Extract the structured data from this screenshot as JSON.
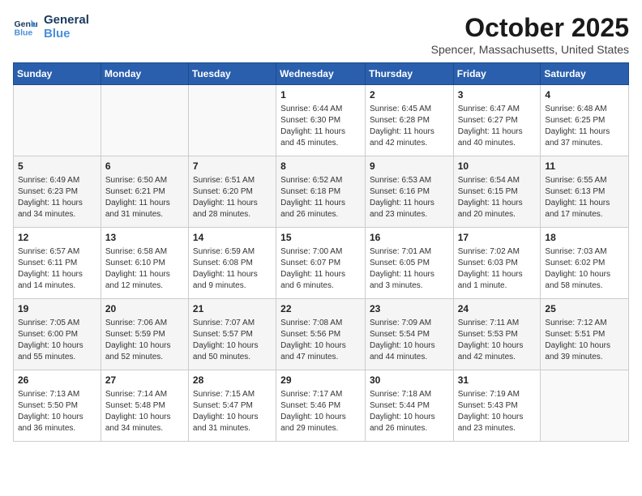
{
  "logo": {
    "line1": "General",
    "line2": "Blue"
  },
  "title": "October 2025",
  "location": "Spencer, Massachusetts, United States",
  "days_of_week": [
    "Sunday",
    "Monday",
    "Tuesday",
    "Wednesday",
    "Thursday",
    "Friday",
    "Saturday"
  ],
  "weeks": [
    [
      {
        "day": "",
        "info": ""
      },
      {
        "day": "",
        "info": ""
      },
      {
        "day": "",
        "info": ""
      },
      {
        "day": "1",
        "info": "Sunrise: 6:44 AM\nSunset: 6:30 PM\nDaylight: 11 hours and 45 minutes."
      },
      {
        "day": "2",
        "info": "Sunrise: 6:45 AM\nSunset: 6:28 PM\nDaylight: 11 hours and 42 minutes."
      },
      {
        "day": "3",
        "info": "Sunrise: 6:47 AM\nSunset: 6:27 PM\nDaylight: 11 hours and 40 minutes."
      },
      {
        "day": "4",
        "info": "Sunrise: 6:48 AM\nSunset: 6:25 PM\nDaylight: 11 hours and 37 minutes."
      }
    ],
    [
      {
        "day": "5",
        "info": "Sunrise: 6:49 AM\nSunset: 6:23 PM\nDaylight: 11 hours and 34 minutes."
      },
      {
        "day": "6",
        "info": "Sunrise: 6:50 AM\nSunset: 6:21 PM\nDaylight: 11 hours and 31 minutes."
      },
      {
        "day": "7",
        "info": "Sunrise: 6:51 AM\nSunset: 6:20 PM\nDaylight: 11 hours and 28 minutes."
      },
      {
        "day": "8",
        "info": "Sunrise: 6:52 AM\nSunset: 6:18 PM\nDaylight: 11 hours and 26 minutes."
      },
      {
        "day": "9",
        "info": "Sunrise: 6:53 AM\nSunset: 6:16 PM\nDaylight: 11 hours and 23 minutes."
      },
      {
        "day": "10",
        "info": "Sunrise: 6:54 AM\nSunset: 6:15 PM\nDaylight: 11 hours and 20 minutes."
      },
      {
        "day": "11",
        "info": "Sunrise: 6:55 AM\nSunset: 6:13 PM\nDaylight: 11 hours and 17 minutes."
      }
    ],
    [
      {
        "day": "12",
        "info": "Sunrise: 6:57 AM\nSunset: 6:11 PM\nDaylight: 11 hours and 14 minutes."
      },
      {
        "day": "13",
        "info": "Sunrise: 6:58 AM\nSunset: 6:10 PM\nDaylight: 11 hours and 12 minutes."
      },
      {
        "day": "14",
        "info": "Sunrise: 6:59 AM\nSunset: 6:08 PM\nDaylight: 11 hours and 9 minutes."
      },
      {
        "day": "15",
        "info": "Sunrise: 7:00 AM\nSunset: 6:07 PM\nDaylight: 11 hours and 6 minutes."
      },
      {
        "day": "16",
        "info": "Sunrise: 7:01 AM\nSunset: 6:05 PM\nDaylight: 11 hours and 3 minutes."
      },
      {
        "day": "17",
        "info": "Sunrise: 7:02 AM\nSunset: 6:03 PM\nDaylight: 11 hours and 1 minute."
      },
      {
        "day": "18",
        "info": "Sunrise: 7:03 AM\nSunset: 6:02 PM\nDaylight: 10 hours and 58 minutes."
      }
    ],
    [
      {
        "day": "19",
        "info": "Sunrise: 7:05 AM\nSunset: 6:00 PM\nDaylight: 10 hours and 55 minutes."
      },
      {
        "day": "20",
        "info": "Sunrise: 7:06 AM\nSunset: 5:59 PM\nDaylight: 10 hours and 52 minutes."
      },
      {
        "day": "21",
        "info": "Sunrise: 7:07 AM\nSunset: 5:57 PM\nDaylight: 10 hours and 50 minutes."
      },
      {
        "day": "22",
        "info": "Sunrise: 7:08 AM\nSunset: 5:56 PM\nDaylight: 10 hours and 47 minutes."
      },
      {
        "day": "23",
        "info": "Sunrise: 7:09 AM\nSunset: 5:54 PM\nDaylight: 10 hours and 44 minutes."
      },
      {
        "day": "24",
        "info": "Sunrise: 7:11 AM\nSunset: 5:53 PM\nDaylight: 10 hours and 42 minutes."
      },
      {
        "day": "25",
        "info": "Sunrise: 7:12 AM\nSunset: 5:51 PM\nDaylight: 10 hours and 39 minutes."
      }
    ],
    [
      {
        "day": "26",
        "info": "Sunrise: 7:13 AM\nSunset: 5:50 PM\nDaylight: 10 hours and 36 minutes."
      },
      {
        "day": "27",
        "info": "Sunrise: 7:14 AM\nSunset: 5:48 PM\nDaylight: 10 hours and 34 minutes."
      },
      {
        "day": "28",
        "info": "Sunrise: 7:15 AM\nSunset: 5:47 PM\nDaylight: 10 hours and 31 minutes."
      },
      {
        "day": "29",
        "info": "Sunrise: 7:17 AM\nSunset: 5:46 PM\nDaylight: 10 hours and 29 minutes."
      },
      {
        "day": "30",
        "info": "Sunrise: 7:18 AM\nSunset: 5:44 PM\nDaylight: 10 hours and 26 minutes."
      },
      {
        "day": "31",
        "info": "Sunrise: 7:19 AM\nSunset: 5:43 PM\nDaylight: 10 hours and 23 minutes."
      },
      {
        "day": "",
        "info": ""
      }
    ]
  ]
}
